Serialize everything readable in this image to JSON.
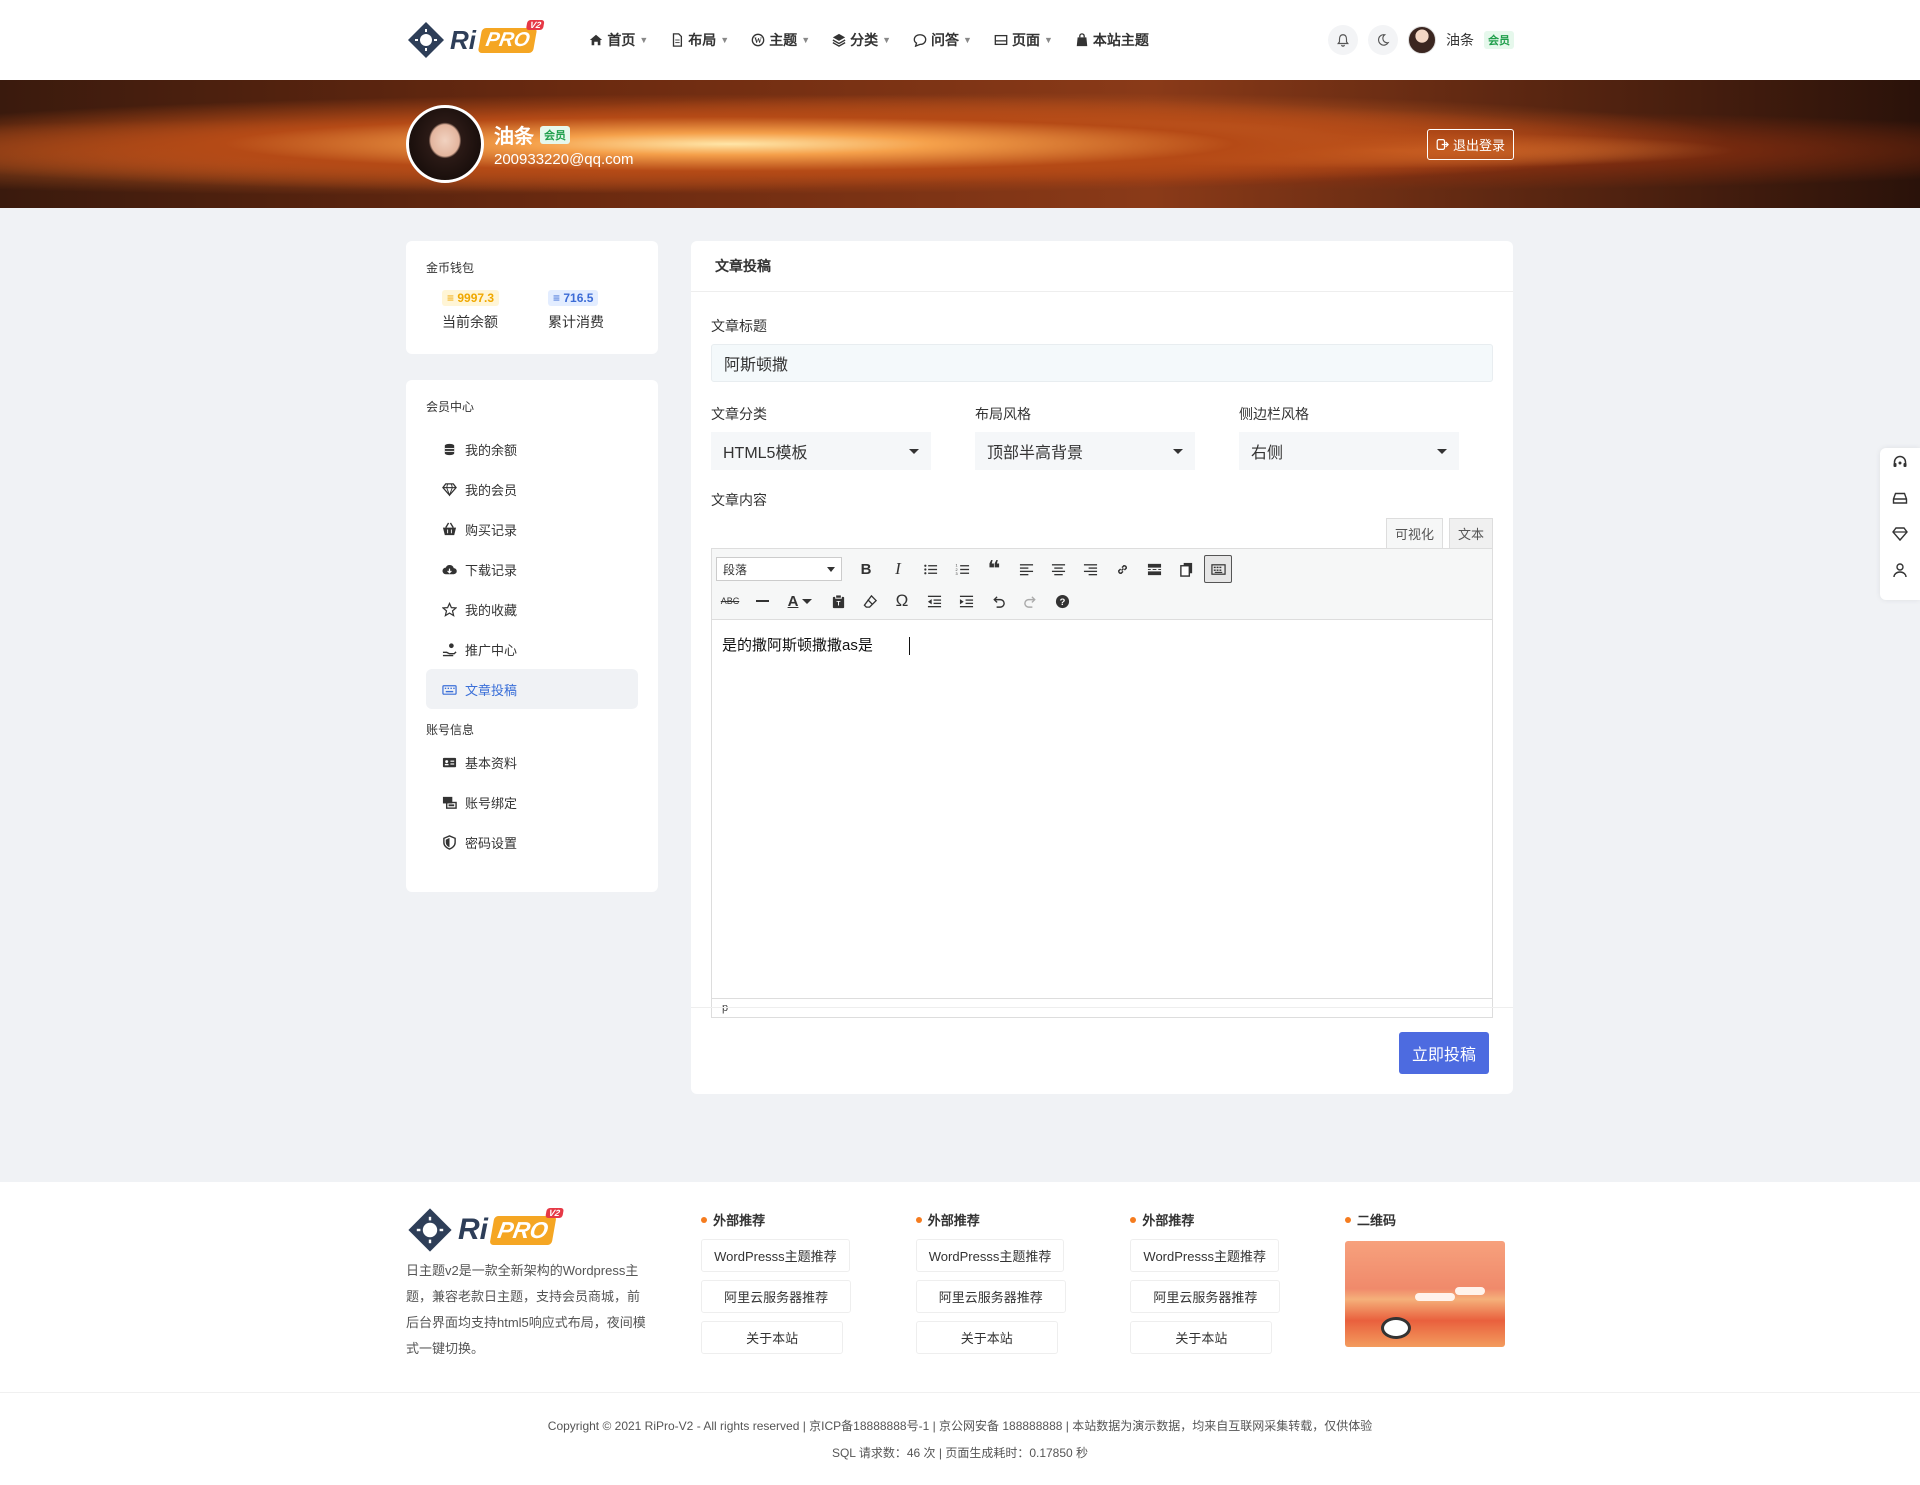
{
  "header": {
    "logo_text": "Ri",
    "logo_pro": "PRO",
    "logo_badge": "V2",
    "nav": [
      {
        "label": "首页",
        "icon": "home-icon"
      },
      {
        "label": "布局",
        "icon": "file-icon"
      },
      {
        "label": "主题",
        "icon": "wordpress-icon"
      },
      {
        "label": "分类",
        "icon": "layers-icon"
      },
      {
        "label": "问答",
        "icon": "chat-icon"
      },
      {
        "label": "页面",
        "icon": "window-icon"
      },
      {
        "label": "本站主题",
        "icon": "bag-icon"
      }
    ],
    "user_name": "油条",
    "vip_badge": "会员"
  },
  "profile": {
    "name": "油条",
    "vip_badge": "会员",
    "email": "200933220@qq.com",
    "logout_label": "退出登录"
  },
  "wallet": {
    "title": "金币钱包",
    "balance_value": "9997.3",
    "balance_label": "当前余额",
    "spent_value": "716.5",
    "spent_label": "累计消费"
  },
  "member_center": {
    "title": "会员中心",
    "items": [
      {
        "label": "我的余额",
        "icon": "coins-icon"
      },
      {
        "label": "我的会员",
        "icon": "diamond-icon"
      },
      {
        "label": "购买记录",
        "icon": "basket-icon"
      },
      {
        "label": "下载记录",
        "icon": "cloud-download-icon"
      },
      {
        "label": "我的收藏",
        "icon": "star-icon"
      },
      {
        "label": "推广中心",
        "icon": "hand-coin-icon"
      },
      {
        "label": "文章投稿",
        "icon": "keyboard-icon"
      }
    ],
    "account_title": "账号信息",
    "account_items": [
      {
        "label": "基本资料",
        "icon": "id-card-icon"
      },
      {
        "label": "账号绑定",
        "icon": "link-icon"
      },
      {
        "label": "密码设置",
        "icon": "shield-icon"
      }
    ]
  },
  "post_form": {
    "header": "文章投稿",
    "title_label": "文章标题",
    "title_value": "阿斯顿撒",
    "category_label": "文章分类",
    "category_value": "HTML5模板",
    "layout_label": "布局风格",
    "layout_value": "顶部半高背景",
    "sidebar_label": "侧边栏风格",
    "sidebar_value": "右侧",
    "content_label": "文章内容",
    "tab_visual": "可视化",
    "tab_text": "文本",
    "format_select": "段落",
    "content_text": "是的撒阿斯顿撒撒as是",
    "status_path": "p",
    "submit_label": "立即投稿"
  },
  "footer": {
    "logo_text": "Ri",
    "logo_pro": "PRO",
    "logo_badge": "V2",
    "description": "日主题v2是一款全新架构的Wordpress主题，兼容老款日主题，支持会员商城，前后台界面均支持html5响应式布局，夜间模式一键切换。",
    "columns": [
      {
        "title": "外部推荐",
        "links": [
          "WordPresss主题推荐",
          "阿里云服务器推荐",
          "关于本站"
        ]
      },
      {
        "title": "外部推荐",
        "links": [
          "WordPresss主题推荐",
          "阿里云服务器推荐",
          "关于本站"
        ]
      },
      {
        "title": "外部推荐",
        "links": [
          "WordPresss主题推荐",
          "阿里云服务器推荐",
          "关于本站"
        ]
      }
    ],
    "qr_title": "二维码",
    "copyright": "Copyright © 2021  RiPro-V2  - All rights reserved |  京ICP备18888888号-1  |  京公网安备 188888888  | 本站数据为演示数据，均来自互联网采集转载，仅供体验",
    "stats": "SQL 请求数：46 次 | 页面生成耗时：0.17850 秒"
  },
  "colors": {
    "accent_blue": "#4d6be0",
    "vip_green": "#1e9e4a",
    "coin_yellow": "#f0a800",
    "footer_dot": "#f57c1f"
  }
}
